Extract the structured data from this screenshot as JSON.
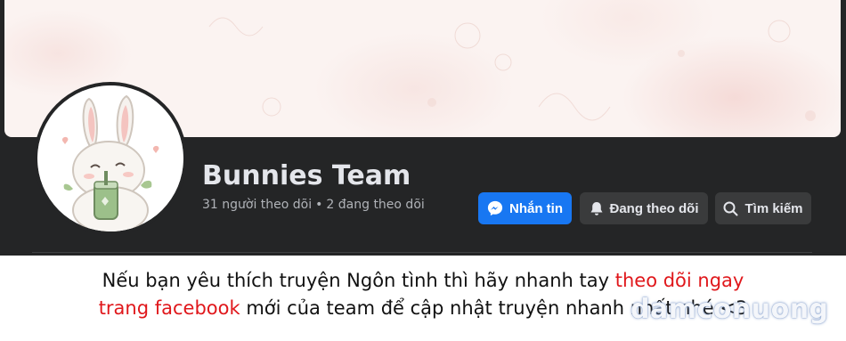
{
  "profile": {
    "name": "Bunnies Team",
    "followers": "31 người theo dõi",
    "separator": "•",
    "following": "2 đang theo dõi"
  },
  "actions": {
    "message_label": "Nhắn tin",
    "following_label": "Đang theo dõi",
    "search_label": "Tìm kiếm"
  },
  "caption": {
    "line1_normal": "Nếu bạn yêu thích truyện Ngôn tình thì hãy nhanh tay ",
    "line1_highlight": "theo dõi ngay",
    "line2_highlight": "trang facebook",
    "line2_normal": " mới của team để cập nhật truyện nhanh nhất nhé <3"
  },
  "watermark": "damconuong",
  "colors": {
    "panel_bg": "#242526",
    "name_text": "#e4e6eb",
    "stats_text": "#b0b3b8",
    "primary_button": "#1877f2",
    "secondary_button": "#3a3b3c",
    "caption_highlight": "#e0171b"
  },
  "icons": {
    "message": "messenger-icon",
    "following": "bell-icon",
    "search": "search-icon"
  }
}
